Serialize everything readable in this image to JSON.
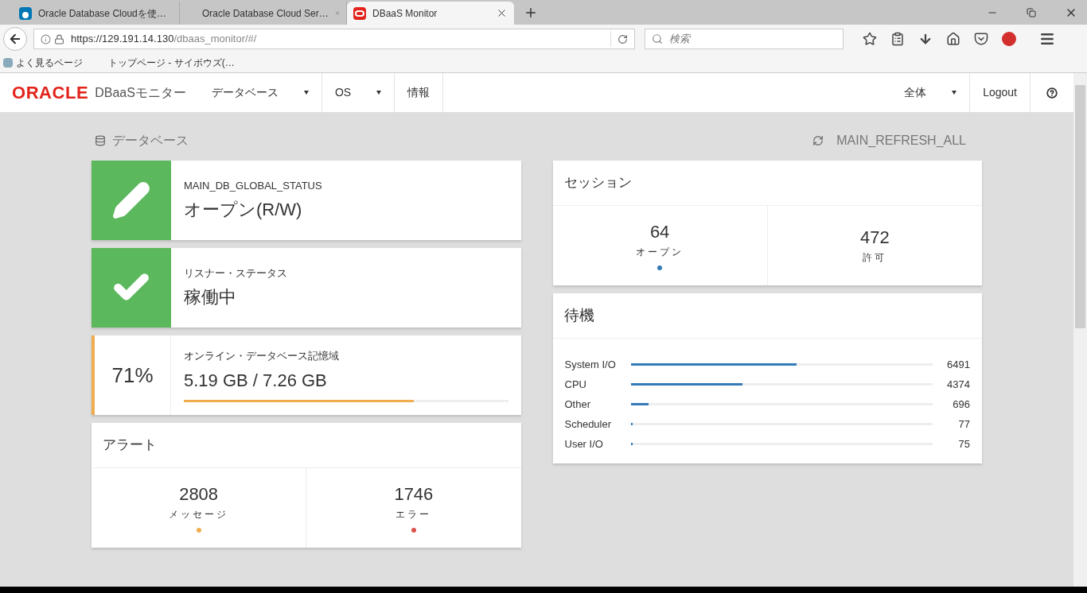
{
  "browser": {
    "tabs": [
      {
        "title": "Oracle Database Cloudを使…",
        "kind": "linkedin",
        "selected": false
      },
      {
        "title": "Oracle Database Cloud Ser…",
        "kind": "plain",
        "selected": false
      },
      {
        "title": "DBaaS Monitor",
        "kind": "oracle",
        "selected": true
      }
    ],
    "url_host": "https://129.191.14.130",
    "url_path": "/dbaas_monitor/#/",
    "search": {
      "placeholder": "検索"
    },
    "bookmarks": [
      {
        "label": "よく見るページ",
        "kind": "page"
      },
      {
        "label": "トップページ - サイボウズ(…",
        "kind": "seven"
      }
    ]
  },
  "navbar": {
    "logo": "ORACLE",
    "app_name": "DBaaSモニター",
    "menu": [
      {
        "label": "データベース",
        "dropdown": true
      },
      {
        "label": "OS",
        "dropdown": true
      },
      {
        "label": "情報",
        "dropdown": false
      }
    ],
    "right_menu": [
      {
        "label": "全体",
        "dropdown": true
      },
      {
        "label": "Logout",
        "dropdown": false
      }
    ]
  },
  "section": {
    "title": "データベース",
    "refresh": "MAIN_REFRESH_ALL"
  },
  "status_cards": [
    {
      "kind": "status",
      "label": "MAIN_DB_GLOBAL_STATUS",
      "value": "オープン(R/W)"
    },
    {
      "kind": "status",
      "label": "リスナー・ステータス",
      "value": "稼働中"
    },
    {
      "kind": "storage",
      "percent": "71%",
      "label": "オンライン・データベース記憶域",
      "value": "5.19 GB / 7.26 GB",
      "level": 0.71
    }
  ],
  "alerts": {
    "title": "アラート",
    "stats": [
      {
        "value": "2808",
        "label": "メッセージ",
        "color": "#f0ad4e"
      },
      {
        "value": "1746",
        "label": "エラー",
        "color": "#d9534f"
      }
    ]
  },
  "sessions": {
    "title": "セッション",
    "stats": [
      {
        "value": "64",
        "label": "オープン",
        "color": "#337ab7"
      },
      {
        "value": "472",
        "label": "許可"
      }
    ]
  },
  "waits": {
    "title": "待機",
    "rows": [
      {
        "name": "System I/O",
        "value": "6491",
        "level": 0.55
      },
      {
        "name": "CPU",
        "value": "4374",
        "level": 0.37
      },
      {
        "name": "Other",
        "value": "696",
        "level": 0.058
      },
      {
        "name": "Scheduler",
        "value": "77",
        "level": 0.007
      },
      {
        "name": "User I/O",
        "value": "75",
        "level": 0.007
      }
    ]
  }
}
